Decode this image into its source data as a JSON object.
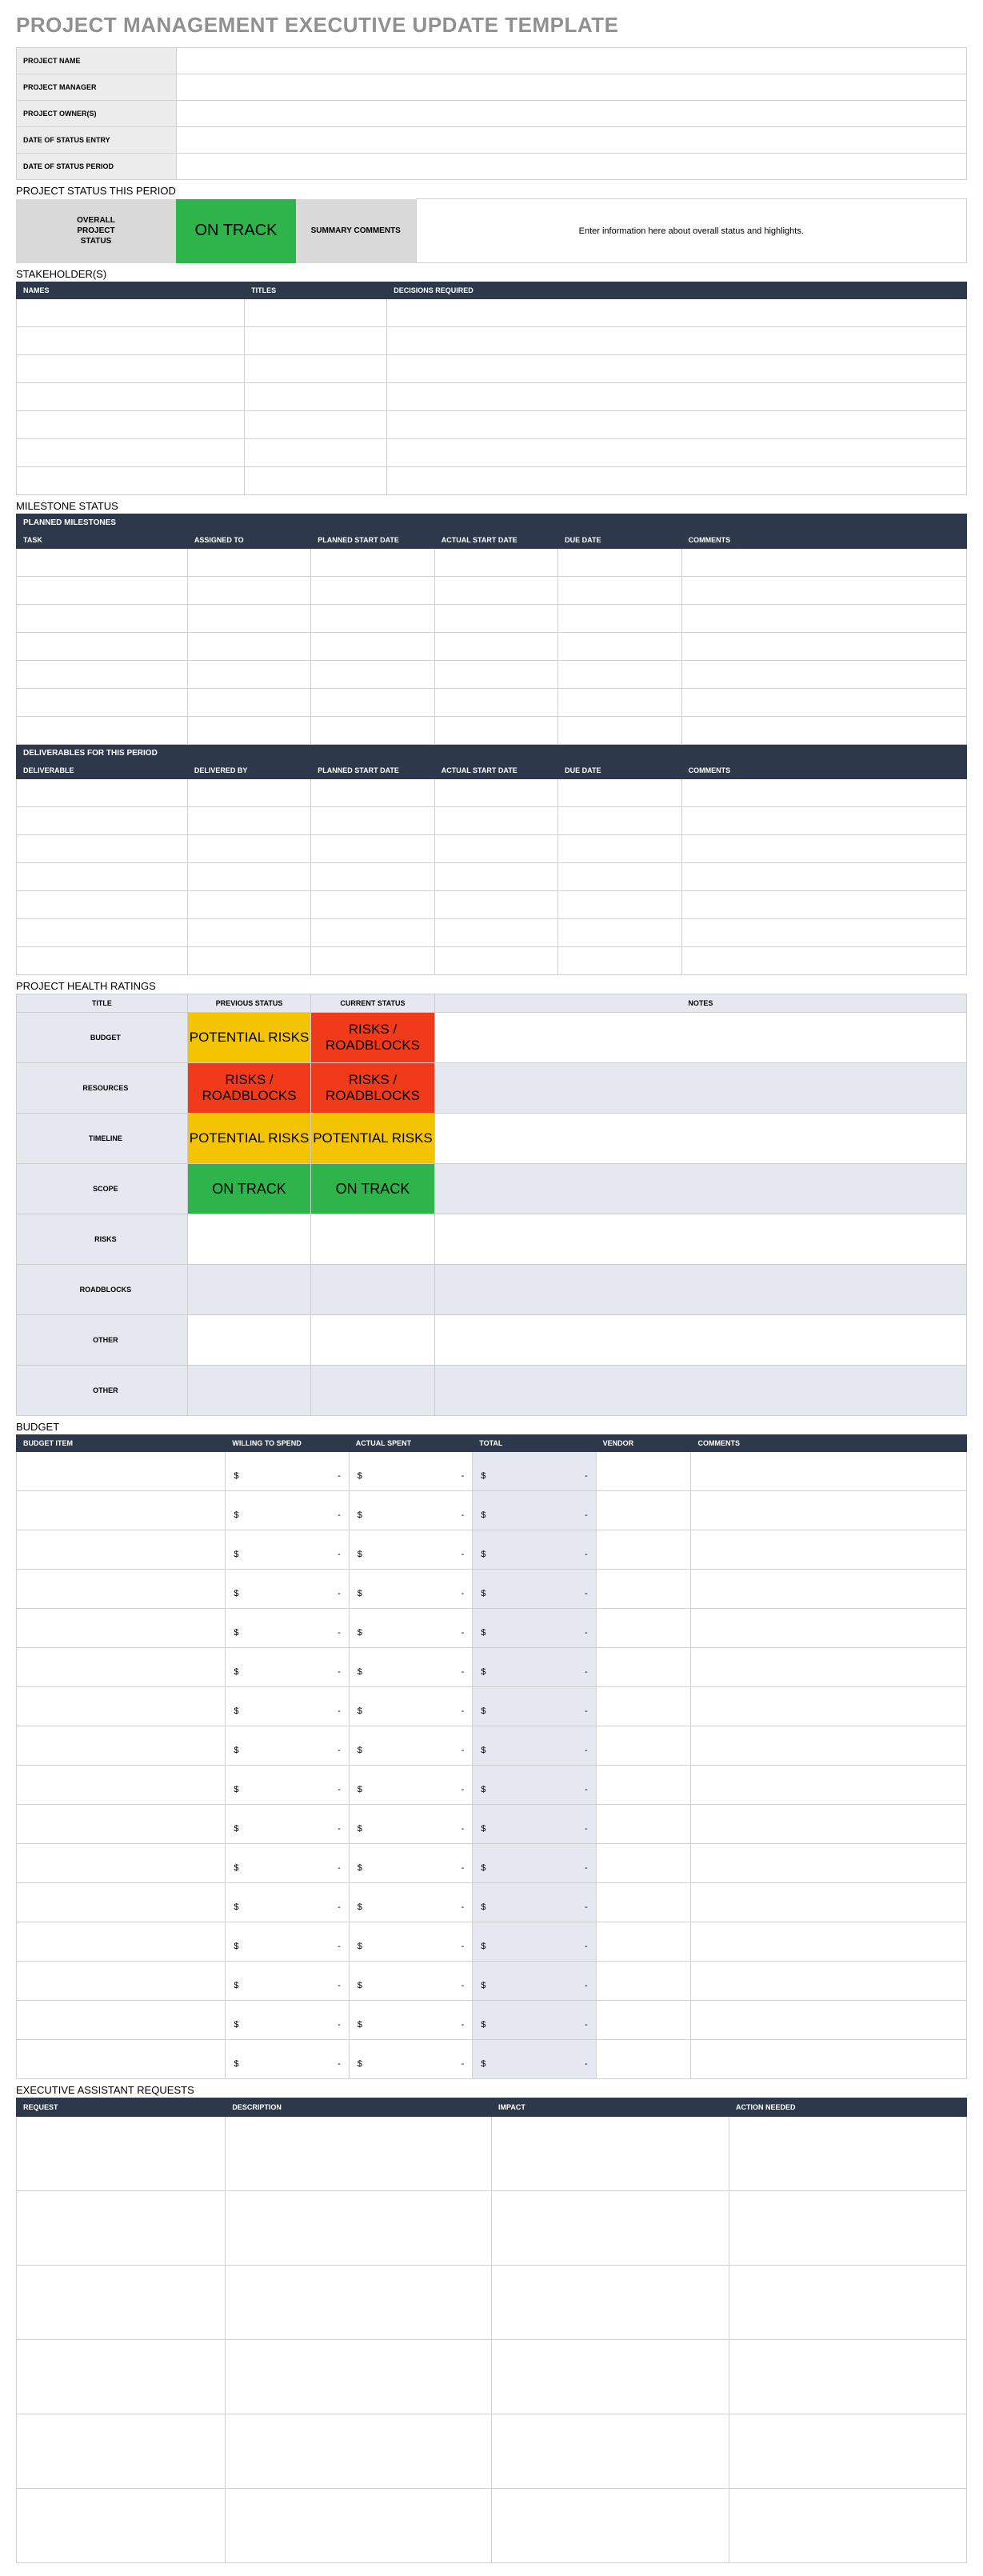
{
  "title": "PROJECT MANAGEMENT EXECUTIVE UPDATE TEMPLATE",
  "info": {
    "labels": [
      "PROJECT NAME",
      "PROJECT MANAGER",
      "PROJECT OWNER(S)",
      "DATE OF STATUS ENTRY",
      "DATE OF STATUS PERIOD"
    ]
  },
  "sections": {
    "status": "PROJECT STATUS THIS PERIOD",
    "stakeholders": "STAKEHOLDER(S)",
    "milestone": "MILESTONE STATUS",
    "health": "PROJECT HEALTH RATINGS",
    "budget": "BUDGET",
    "exec": "EXECUTIVE ASSISTANT REQUESTS"
  },
  "status_block": {
    "overall": "OVERALL\nPROJECT\nSTATUS",
    "value": "ON TRACK",
    "summary": "SUMMARY COMMENTS",
    "comment": "Enter information here about overall status and highlights."
  },
  "stakeholders": {
    "headers": [
      "NAMES",
      "TITLES",
      "DECISIONS REQUIRED"
    ],
    "rows": 7
  },
  "milestone": {
    "planned_band": "PLANNED MILESTONES",
    "planned_headers": [
      "TASK",
      "ASSIGNED TO",
      "PLANNED START DATE",
      "ACTUAL START DATE",
      "DUE DATE",
      "COMMENTS"
    ],
    "planned_rows": 7,
    "deliv_band": "DELIVERABLES FOR THIS PERIOD",
    "deliv_headers": [
      "DELIVERABLE",
      "DELIVERED BY",
      "PLANNED START DATE",
      "ACTUAL START DATE",
      "DUE DATE",
      "COMMENTS"
    ],
    "deliv_rows": 7
  },
  "health": {
    "headers": [
      "TITLE",
      "PREVIOUS STATUS",
      "CURRENT STATUS",
      "NOTES"
    ],
    "rows": [
      {
        "title": "BUDGET",
        "prev": "POTENTIAL RISKS",
        "prev_cls": "st-yellow",
        "cur": "RISKS / ROADBLOCKS",
        "cur_cls": "st-red",
        "alt": false
      },
      {
        "title": "RESOURCES",
        "prev": "RISKS / ROADBLOCKS",
        "prev_cls": "st-red",
        "cur": "RISKS / ROADBLOCKS",
        "cur_cls": "st-red",
        "alt": true
      },
      {
        "title": "TIMELINE",
        "prev": "POTENTIAL RISKS",
        "prev_cls": "st-yellow",
        "cur": "POTENTIAL RISKS",
        "cur_cls": "st-yellow",
        "alt": false
      },
      {
        "title": "SCOPE",
        "prev": "ON TRACK",
        "prev_cls": "st-green",
        "cur": "ON TRACK",
        "cur_cls": "st-green",
        "alt": true
      },
      {
        "title": "RISKS",
        "prev": "",
        "prev_cls": "",
        "cur": "",
        "cur_cls": "",
        "alt": false
      },
      {
        "title": "ROADBLOCKS",
        "prev": "",
        "prev_cls": "",
        "cur": "",
        "cur_cls": "",
        "alt": true
      },
      {
        "title": "OTHER",
        "prev": "",
        "prev_cls": "",
        "cur": "",
        "cur_cls": "",
        "alt": false
      },
      {
        "title": "OTHER",
        "prev": "",
        "prev_cls": "",
        "cur": "",
        "cur_cls": "",
        "alt": true
      }
    ]
  },
  "budget": {
    "headers": [
      "BUDGET ITEM",
      "WILLING TO SPEND",
      "ACTUAL SPENT",
      "TOTAL",
      "VENDOR",
      "COMMENTS"
    ],
    "currency": "$",
    "dash": "-",
    "rows": 16
  },
  "exec": {
    "headers": [
      "REQUEST",
      "DESCRIPTION",
      "IMPACT",
      "ACTION NEEDED"
    ],
    "rows": 6
  }
}
